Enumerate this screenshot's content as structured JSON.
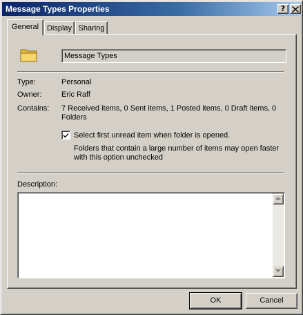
{
  "window": {
    "title": "Message Types Properties",
    "help_label": "?",
    "close_label": "✕"
  },
  "tabs": [
    {
      "label": "General",
      "active": true
    },
    {
      "label": "Display",
      "active": false
    },
    {
      "label": "Sharing",
      "active": false
    }
  ],
  "general": {
    "folder_icon": "folder-icon",
    "folder_name": "Message Types",
    "type_label": "Type:",
    "type_value": "Personal",
    "owner_label": "Owner:",
    "owner_value": "Eric Raff",
    "contains_label": "Contains:",
    "contains_value": "7 Received items, 0 Sent items, 1 Posted items, 0 Draft items, 0 Folders",
    "select_unread_checked": true,
    "select_unread_label": "Select first unread item when folder is opened.",
    "select_unread_note": "Folders that contain a large number of items may open faster with this option unchecked",
    "description_label": "Description:",
    "description_value": ""
  },
  "buttons": {
    "ok": "OK",
    "cancel": "Cancel"
  }
}
